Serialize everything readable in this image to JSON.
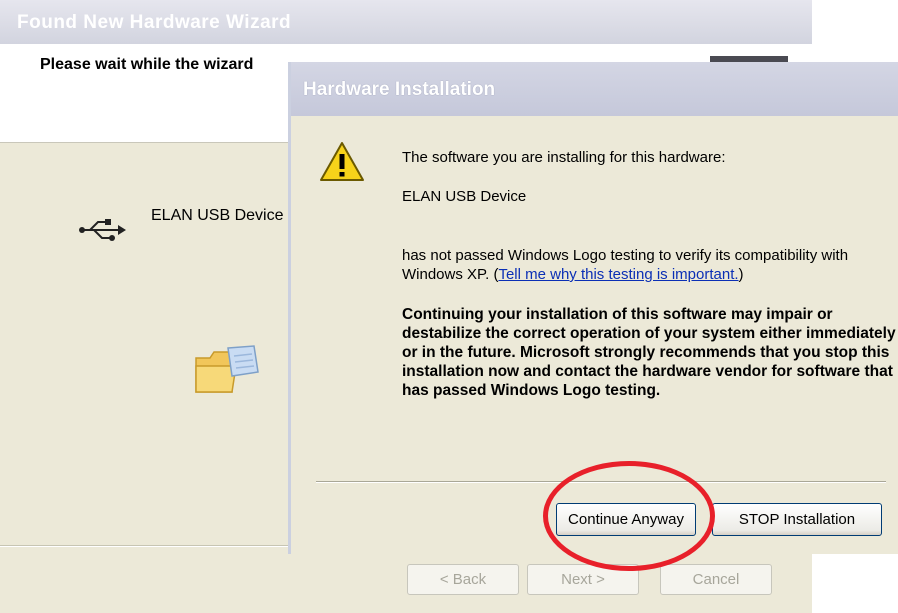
{
  "wizard": {
    "title": "Found New Hardware Wizard",
    "header_text": "Please wait while the wizard",
    "device_name": "ELAN USB Device",
    "buttons": {
      "back": "< Back",
      "next": "Next >",
      "cancel": "Cancel"
    }
  },
  "dialog": {
    "title": "Hardware Installation",
    "line1": "The software you are installing for this hardware:",
    "device": "ELAN USB Device",
    "para1": "has not passed Windows Logo testing to verify its compatibility with Windows XP.",
    "para1_prefix": "(",
    "link": "Tell me why this testing is important.",
    "para1_suffix": ")",
    "warning": "Continuing your installation of this software may impair or destabilize the correct operation of your system either immediately or in the future. Microsoft strongly recommends that you stop this installation now and contact the hardware vendor for software that has passed Windows Logo testing.",
    "buttons": {
      "continue": "Continue Anyway",
      "stop": "STOP Installation"
    }
  },
  "colors": {
    "highlight_circle": "#e8202a",
    "link": "#0b2fb5"
  }
}
